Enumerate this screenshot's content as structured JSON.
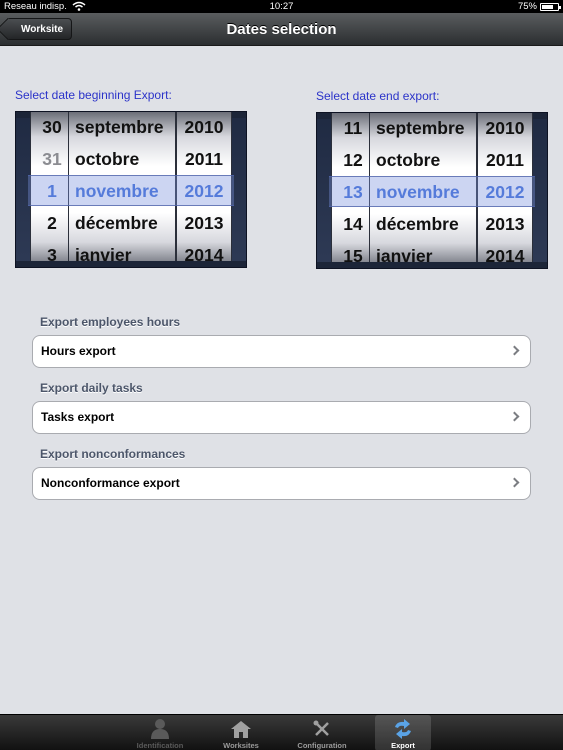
{
  "status_bar": {
    "carrier": "Reseau indisp.",
    "time": "10:27",
    "battery": "75%",
    "battery_level": 0.75
  },
  "nav": {
    "back_label": "Worksite",
    "title": "Dates selection"
  },
  "begin_picker": {
    "label": "Select date beginning Export:",
    "days": [
      "30",
      "31",
      "1",
      "2",
      "3"
    ],
    "months": [
      "septembre",
      "octobre",
      "novembre",
      "décembre",
      "janvier"
    ],
    "years": [
      "2010",
      "2011",
      "2012",
      "2013",
      "2014"
    ],
    "selected": {
      "day": "1",
      "month": "novembre",
      "year": "2012"
    }
  },
  "end_picker": {
    "label": "Select date end export:",
    "days": [
      "11",
      "12",
      "13",
      "14",
      "15"
    ],
    "months": [
      "septembre",
      "octobre",
      "novembre",
      "décembre",
      "janvier"
    ],
    "years": [
      "2010",
      "2011",
      "2012",
      "2013",
      "2014"
    ],
    "selected": {
      "day": "13",
      "month": "novembre",
      "year": "2012"
    }
  },
  "sections": [
    {
      "header": "Export employees hours",
      "cell": "Hours export"
    },
    {
      "header": "Export daily tasks",
      "cell": "Tasks export"
    },
    {
      "header": "Export nonconformances",
      "cell": "Nonconformance export"
    }
  ],
  "tabs": [
    {
      "label": "Identification",
      "icon": "person-icon",
      "state": "disabled"
    },
    {
      "label": "Worksites",
      "icon": "house-icon",
      "state": "normal"
    },
    {
      "label": "Configuration",
      "icon": "tools-icon",
      "state": "normal"
    },
    {
      "label": "Export",
      "icon": "export-icon",
      "state": "active"
    }
  ],
  "colors": {
    "accent": "#2b33c9",
    "selected_text": "#3f6ed8",
    "background": "#dfe1e6"
  }
}
